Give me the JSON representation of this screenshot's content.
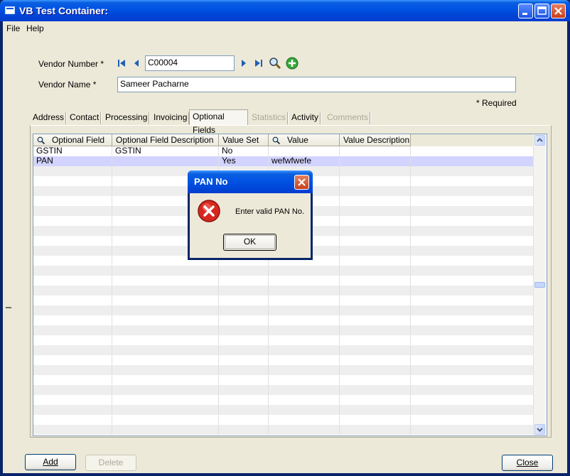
{
  "window": {
    "title": "VB Test Container:"
  },
  "menu": [
    "File",
    "Help"
  ],
  "vendor": {
    "number_label": "Vendor Number *",
    "number_value": "C00004",
    "name_label": "Vendor Name *",
    "name_value": "Sameer Pacharne",
    "required_note": "*  Required"
  },
  "tabs": [
    {
      "label": "Address",
      "state": "normal"
    },
    {
      "label": "Contact",
      "state": "normal"
    },
    {
      "label": "Processing",
      "state": "normal"
    },
    {
      "label": "Invoicing",
      "state": "normal"
    },
    {
      "label": "Optional Fields",
      "state": "active"
    },
    {
      "label": "Statistics",
      "state": "disabled"
    },
    {
      "label": "Activity",
      "state": "normal"
    },
    {
      "label": "Comments",
      "state": "disabled"
    }
  ],
  "grid": {
    "columns": [
      "Optional Field",
      "Optional Field Description",
      "Value Set",
      "Value",
      "Value Description"
    ],
    "rows": [
      [
        "GSTIN",
        "GSTIN",
        "No",
        "",
        ""
      ],
      [
        "PAN",
        "",
        "Yes",
        "wefwfwefe",
        ""
      ]
    ]
  },
  "buttons": {
    "add": "Add",
    "delete": "Delete",
    "close": "Close"
  },
  "dialog": {
    "title": "PAN No",
    "message": "Enter valid PAN No.",
    "ok": "OK"
  },
  "colors": {
    "titlebar": "#0054e3",
    "selected_row": "#d3d3ff",
    "window_bg": "#ece9d8"
  }
}
